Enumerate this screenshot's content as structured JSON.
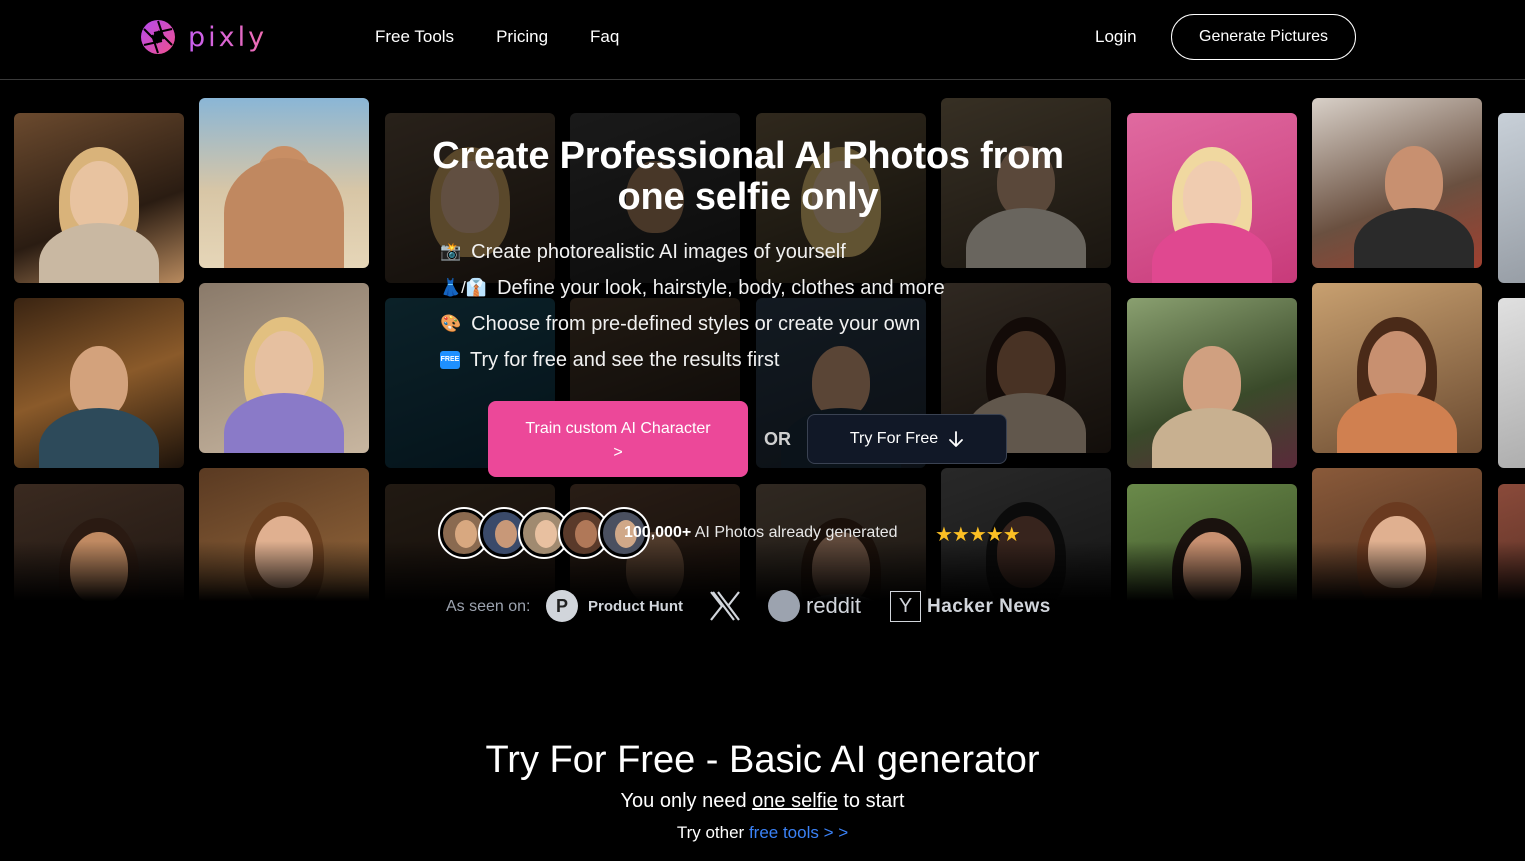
{
  "nav": {
    "logo_text": "pixly",
    "links": [
      "Free Tools",
      "Pricing",
      "Faq"
    ],
    "login": "Login",
    "cta": "Generate Pictures"
  },
  "hero": {
    "title": "Create Professional AI Photos from one selfie only",
    "features": [
      {
        "icon": "camera-icon",
        "emoji": "📸",
        "text": "Create photorealistic AI images of yourself"
      },
      {
        "icon": "dress-shirt-icon",
        "emoji": "👗/👔",
        "text": "Define your look, hairstyle, body, clothes and more"
      },
      {
        "icon": "palette-icon",
        "emoji": "🎨",
        "text": "Choose from pre-defined styles or create your own"
      },
      {
        "icon": "free-badge-icon",
        "emoji": "FREE",
        "text": "Try for free and see the results first"
      }
    ],
    "train_button": "Train custom AI Character",
    "train_arrow": ">",
    "or": "OR",
    "try_button": "Try For Free",
    "count_bold": "100,000+",
    "count_text": "AI Photos already generated",
    "stars": "★★★★★",
    "accent": "#ec4899"
  },
  "seen": {
    "label": "As seen on:",
    "ph_letter": "P",
    "ph_text": "Product Hunt",
    "reddit_text": "reddit",
    "hn_letter": "Y",
    "hn_text": "Hacker News"
  },
  "section2": {
    "title": "Try For Free - Basic AI generator",
    "sub_prefix": "You only need",
    "sub_link": "one selfie",
    "sub_suffix": "to start",
    "other_prefix": "Try other",
    "other_link": "free tools > >"
  }
}
